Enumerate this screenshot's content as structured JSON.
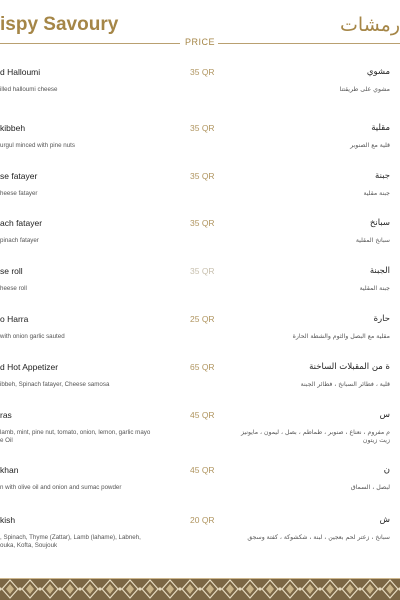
{
  "header": {
    "title_en": "ispy Savoury",
    "title_ar": "رمشات",
    "price_label": "PRICE"
  },
  "items": [
    {
      "en_name": "d Halloumi",
      "en_desc": "illed halloumi cheese",
      "price": "35 QR",
      "ar_name": "مشوي",
      "ar_desc": "مشوي على طريقتنا"
    },
    {
      "en_name": "kibbeh",
      "en_desc": "urgul minced with pine nuts",
      "price": "35 QR",
      "ar_name": "مقلية",
      "ar_desc": "قلية مع الصنوبر"
    },
    {
      "en_name": "se fatayer",
      "en_desc": "heese fatayer",
      "price": "35 QR",
      "ar_name": "جبنة",
      "ar_desc": "جبنة مقلية"
    },
    {
      "en_name": "ach fatayer",
      "en_desc": "pinach fatayer",
      "price": "35 QR",
      "ar_name": "سبانخ",
      "ar_desc": "سبانخ المقلية"
    },
    {
      "en_name": "se roll",
      "en_desc": "heese roll",
      "price": "35 QR",
      "ar_name": "الجبنة",
      "ar_desc": "جبنة المقلية"
    },
    {
      "en_name": "o Harra",
      "en_desc": "with onion garlic sauted",
      "price": "25 QR",
      "ar_name": "حارة",
      "ar_desc": "مقلية مع البصل والثوم والشطة الحارة"
    },
    {
      "en_name": "d Hot Appetizer",
      "en_desc": "ibbeh, Spinach fatayer, Cheese samosa",
      "price": "65 QR",
      "ar_name": "ة من المقبلات الساخنة",
      "ar_desc": "قلية ، فطائر السبانخ ، فطائر الجبنة"
    },
    {
      "en_name": "ras",
      "en_desc": "lamb, mint, pine nut, tomato, onion, lemon, garlic mayo\ne Oil",
      "price": "45 QR",
      "ar_name": "س",
      "ar_desc": "م مفروم ، نعناع ، صنوبر ، طماطم ، بصل ، ليمون ، مايونيز\nزيت زيتون"
    },
    {
      "en_name": "khan",
      "en_desc": "n with olive oil and onion and sumac powder",
      "price": "45 QR",
      "ar_name": "ن",
      "ar_desc": "لبصل ، السماق"
    },
    {
      "en_name": "kish",
      "en_desc": ", Spinach, Thyme (Zattar), Lamb (lahame), Labneh,\nouka, Kofta, Soujouk",
      "price": "20 QR",
      "ar_name": "ش",
      "ar_desc": "سبانخ ، زعتر لحم بعجين ، لبنة ، شكشوكة ، كفتة وسجق"
    }
  ],
  "colors": {
    "accent": "#a58647",
    "footer": "#7b6645"
  }
}
